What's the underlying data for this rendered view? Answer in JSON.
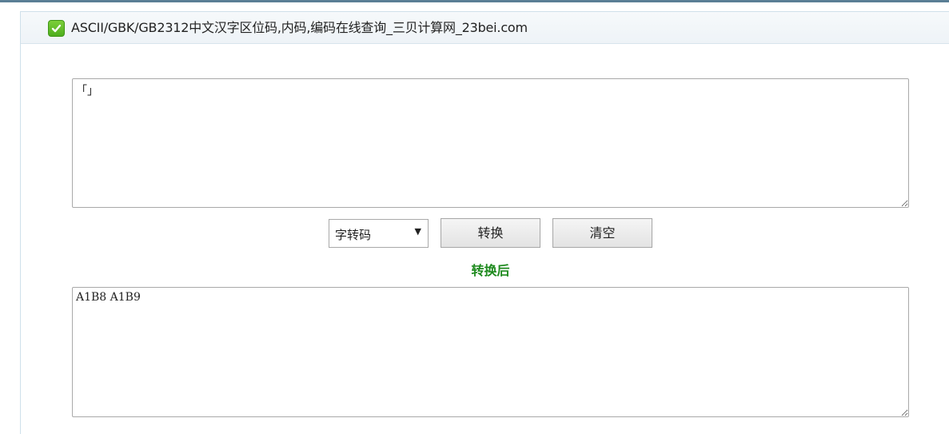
{
  "header": {
    "title": "ASCII/GBK/GB2312中文汉字区位码,内码,编码在线查询_三贝计算网_23bei.com",
    "icon": "check-icon",
    "accent_color": "#4fae1e"
  },
  "input": {
    "value": "「」"
  },
  "controls": {
    "mode_selected": "字转码",
    "convert_label": "转换",
    "clear_label": "清空"
  },
  "result": {
    "label": "转换后",
    "label_color": "#1e8a1e",
    "value": "A1B8 A1B9"
  }
}
